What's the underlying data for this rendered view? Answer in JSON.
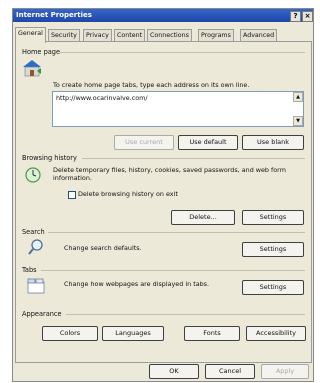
{
  "window": {
    "title": "Internet Properties",
    "help_label": "?",
    "close_label": "×"
  },
  "tabs": [
    "General",
    "Security",
    "Privacy",
    "Content",
    "Connections",
    "Programs",
    "Advanced"
  ],
  "home_page": {
    "section": "Home page",
    "description": "To create home page tabs, type each address on its own line.",
    "url": "http://www.ocarinvalve.com/",
    "scroll_up": "▲",
    "scroll_down": "▼",
    "use_current": "Use current",
    "use_default": "Use default",
    "use_blank": "Use blank"
  },
  "browsing_history": {
    "section": "Browsing history",
    "description": "Delete temporary files, history, cookies, saved passwords, and web form information.",
    "checkbox_label": "Delete browsing history on exit",
    "delete": "Delete...",
    "settings": "Settings"
  },
  "search": {
    "section": "Search",
    "description": "Change search defaults.",
    "settings": "Settings"
  },
  "tabs_section": {
    "section": "Tabs",
    "description": "Change how webpages are displayed in tabs.",
    "settings": "Settings"
  },
  "appearance": {
    "section": "Appearance",
    "colors": "Colors",
    "languages": "Languages",
    "fonts": "Fonts",
    "accessibility": "Accessibility"
  },
  "footer": {
    "ok": "OK",
    "cancel": "Cancel",
    "apply": "Apply"
  }
}
